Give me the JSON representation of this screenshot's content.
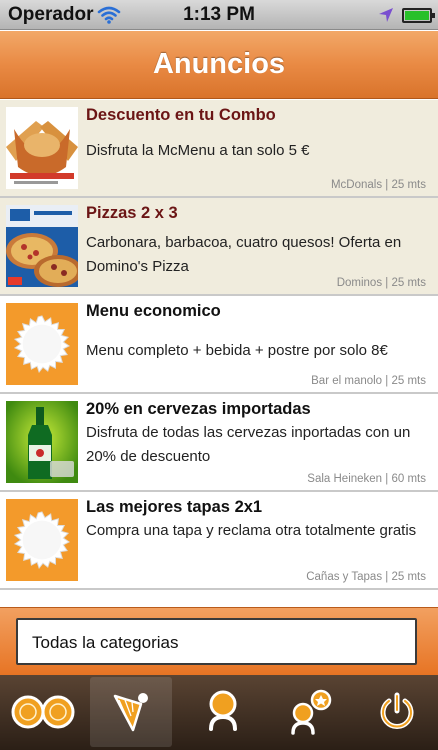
{
  "status": {
    "carrier": "Operador",
    "time": "1:13 PM",
    "icons": [
      "wifi-icon",
      "location-arrow-icon",
      "battery-icon"
    ]
  },
  "nav": {
    "title": "Anuncios"
  },
  "colors": {
    "accent": "#e98a44",
    "featured_row": "#f0ecdd",
    "featured_title": "#6b1515",
    "tabbar": "#3a2a1e",
    "icon_orange": "#f0a020"
  },
  "ads": [
    {
      "title": "Descuento en tu Combo",
      "description": "Disfruta la McMenu a tan solo 5 €",
      "business": "McDonals",
      "distance": "25 mts",
      "featured": true,
      "image": "mcdonalds-promo-image"
    },
    {
      "title": "Pizzas 2 x 3",
      "description": "Carbonara, barbacoa, cuatro quesos! Oferta en Domino's Pizza",
      "business": "Dominos",
      "distance": "25 mts",
      "featured": true,
      "image": "dominos-pizza-image"
    },
    {
      "title": "Menu economico",
      "description": "Menu completo + bebida + postre por solo 8€",
      "business": "Bar el manolo",
      "distance": "25 mts",
      "featured": false,
      "image": "placeholder-seal-icon"
    },
    {
      "title": "20% en cervezas importadas",
      "description": "Disfruta de todas las cervezas inportadas con un 20% de descuento",
      "business": "Sala Heineken",
      "distance": "60 mts",
      "featured": false,
      "image": "heineken-beer-image"
    },
    {
      "title": "Las mejores tapas 2x1",
      "description": "Compra una tapa y reclama otra totalmente gratis",
      "business": "Cañas y Tapas",
      "distance": "25 mts",
      "featured": false,
      "image": "placeholder-seal-icon"
    }
  ],
  "filter": {
    "value": "Todas la categorias"
  },
  "tabs": [
    {
      "icon": "coins-icon",
      "active": false
    },
    {
      "icon": "ice-cream-cone-icon",
      "active": true
    },
    {
      "icon": "person-icon",
      "active": false
    },
    {
      "icon": "person-star-icon",
      "active": false
    },
    {
      "icon": "power-icon",
      "active": false
    }
  ]
}
